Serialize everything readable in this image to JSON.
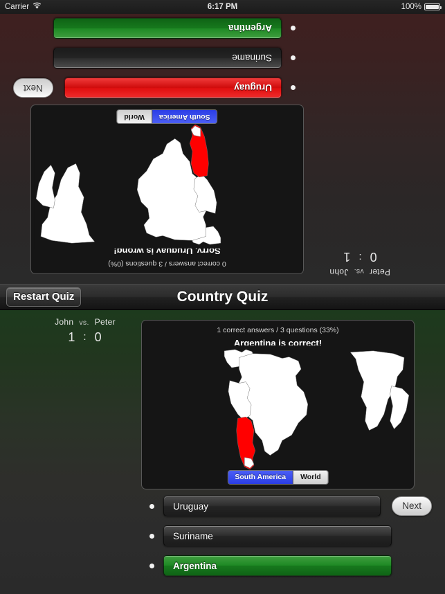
{
  "status_bar": {
    "carrier": "Carrier",
    "wifi_icon": "wifi-icon",
    "time": "6:17 PM",
    "battery_percent": "100%",
    "battery_icon": "battery-full-icon"
  },
  "navbar": {
    "restart_label": "Restart Quiz",
    "title": "Country Quiz"
  },
  "colors": {
    "correct_green": "#1f8a25",
    "wrong_red": "#e00f0f",
    "segment_selected_blue": "#2b3ee6",
    "highlight_country": "#ff0000",
    "map_background": "#151515",
    "top_half_tint": "#402020",
    "bottom_half_tint": "#1d3a1d"
  },
  "player_bottom": {
    "score": {
      "player_left": "John",
      "vs": "vs.",
      "player_right": "Peter",
      "score_left": "1",
      "separator": ":",
      "score_right": "0"
    },
    "map_panel": {
      "stats": "1 correct answers / 3 questions (33%)",
      "verdict": "Argentina is correct!",
      "segments": [
        {
          "label": "South America",
          "selected": true
        },
        {
          "label": "World",
          "selected": false
        }
      ]
    },
    "answers": [
      {
        "label": "Uruguay",
        "state": "neutral"
      },
      {
        "label": "Suriname",
        "state": "neutral"
      },
      {
        "label": "Argentina",
        "state": "correct"
      }
    ],
    "next_label": "Next"
  },
  "player_top": {
    "score": {
      "player_left": "Peter",
      "vs": "vs.",
      "player_right": "John",
      "score_left": "0",
      "separator": ":",
      "score_right": "1"
    },
    "map_panel": {
      "stats": "0 correct answers / 3 questions (0%)",
      "verdict": "Sorry, Uruguay is wrong!",
      "segments": [
        {
          "label": "South America",
          "selected": true
        },
        {
          "label": "World",
          "selected": false
        }
      ]
    },
    "answers": [
      {
        "label": "Uruguay",
        "state": "wrong"
      },
      {
        "label": "Suriname",
        "state": "neutral"
      },
      {
        "label": "Argentina",
        "state": "correct"
      }
    ],
    "next_label": "Next"
  }
}
